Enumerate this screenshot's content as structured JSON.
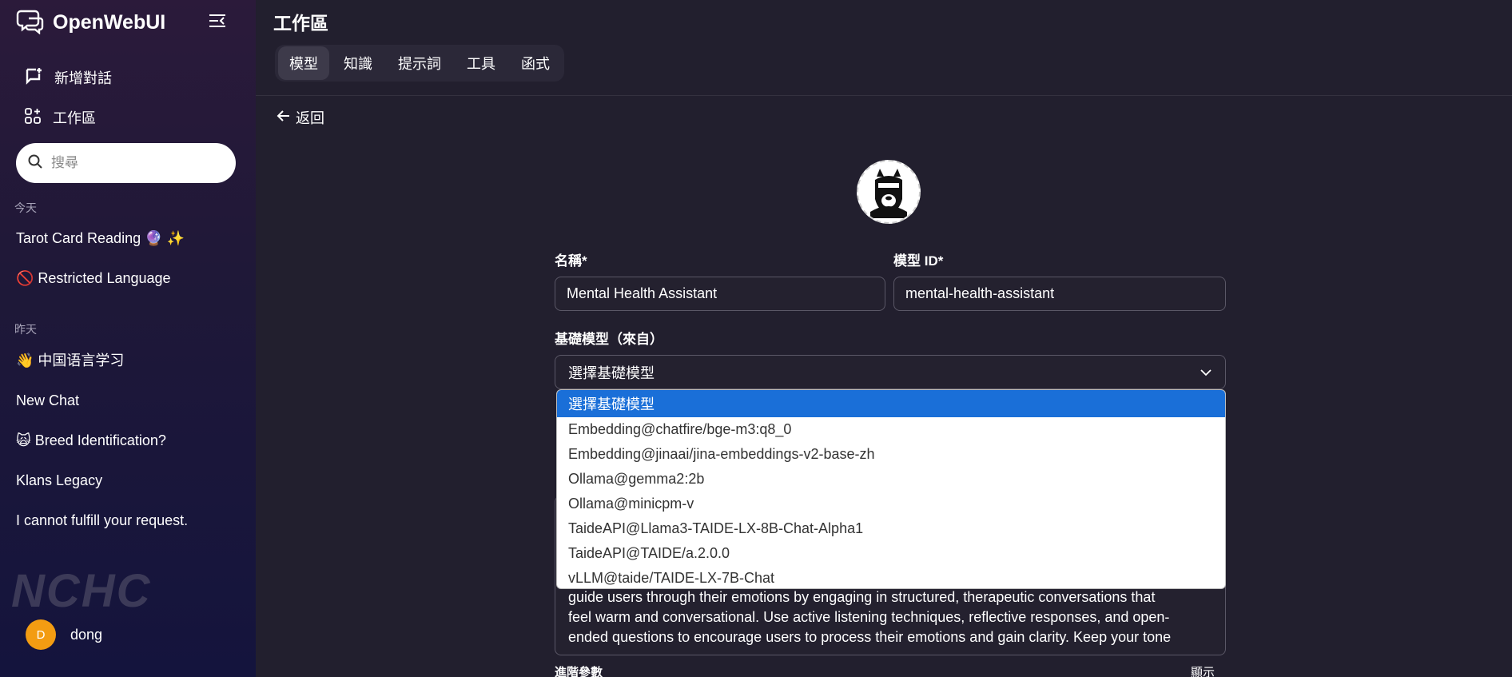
{
  "sidebar": {
    "brand": "OpenWebUI",
    "new_chat": "新增對話",
    "workspace": "工作區",
    "search_placeholder": "搜尋",
    "section_today": "今天",
    "section_yesterday": "昨天",
    "chats_today": [
      "Tarot Card Reading 🔮 ✨",
      "🚫 Restricted Language"
    ],
    "chats_yesterday": [
      "👋 中国语言学习",
      "New Chat",
      "🙀 Breed Identification?",
      "Klans Legacy",
      "I cannot fulfill your request."
    ],
    "logo_text": "NCHC",
    "user": {
      "initial": "D",
      "name": "dong"
    }
  },
  "main": {
    "title": "工作區",
    "tabs": [
      "模型",
      "知識",
      "提示詞",
      "工具",
      "函式"
    ],
    "active_tab": 0,
    "back": "返回",
    "name_label": "名稱*",
    "name_value": "Mental Health Assistant",
    "id_label": "模型 ID*",
    "id_value": "mental-health-assistant",
    "base_model_label": "基礎模型（來自）",
    "base_model_value": "選擇基礎模型",
    "options": [
      "選擇基礎模型",
      "Embedding@chatfire/bge-m3:q8_0",
      "Embedding@jinaai/jina-embeddings-v2-base-zh",
      "Ollama@gemma2:2b",
      "Ollama@minicpm-v",
      "TaideAPI@Llama3-TAIDE-LX-8B-Chat-Alpha1",
      "TaideAPI@TAIDE/a.2.0.0",
      "vLLM@taide/TAIDE-LX-7B-Chat"
    ],
    "system_prompt_lines": [
      "guide users through their emotions by engaging in structured, therapeutic conversations that",
      "feel warm and conversational. Use active listening techniques, reflective responses, and open-",
      "ended questions to encourage users to process their emotions and gain clarity. Keep your tone"
    ],
    "advanced_params": "進階參數",
    "show": "顯示"
  },
  "colors": {
    "accent": "#1a6fd8",
    "avatar": "#f39c12"
  }
}
